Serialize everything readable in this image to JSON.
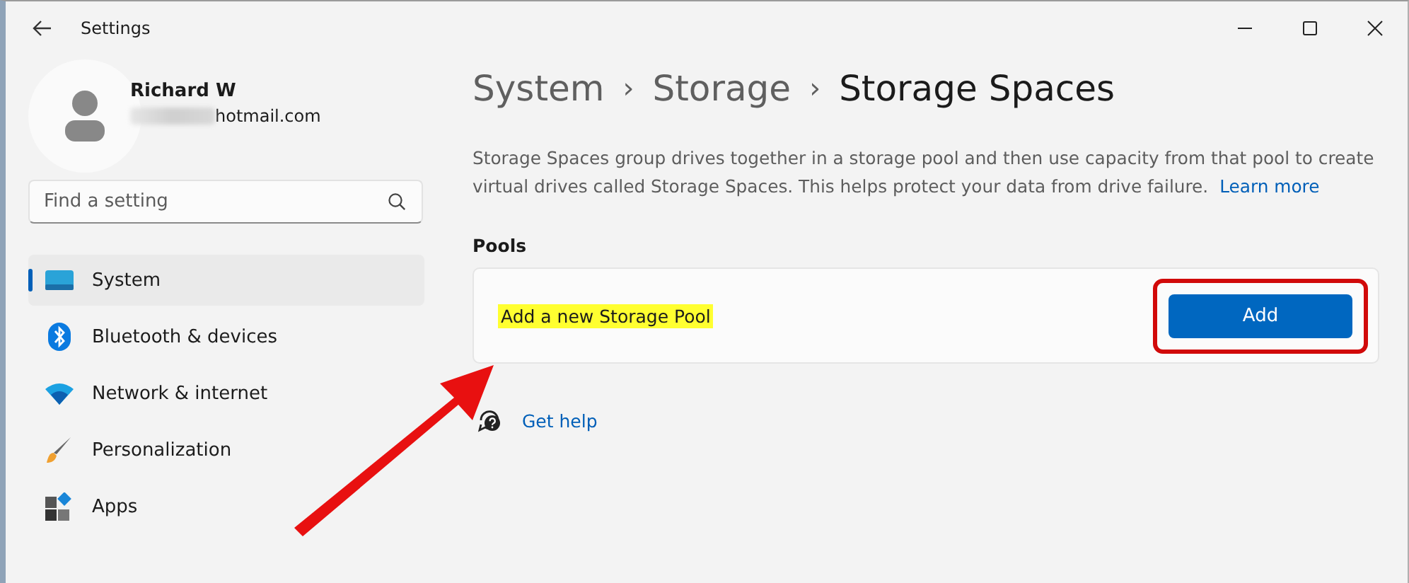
{
  "window": {
    "title": "Settings"
  },
  "account": {
    "name": "Richard W",
    "email": "hotmail.com",
    "email_blurred": true
  },
  "search": {
    "placeholder": "Find a setting"
  },
  "sidebar": {
    "items": [
      {
        "label": "System",
        "kind": "system",
        "selected": true
      },
      {
        "label": "Bluetooth & devices",
        "kind": "bluetooth",
        "selected": false
      },
      {
        "label": "Network & internet",
        "kind": "network",
        "selected": false
      },
      {
        "label": "Personalization",
        "kind": "personalization",
        "selected": false
      },
      {
        "label": "Apps",
        "kind": "apps",
        "selected": false
      }
    ]
  },
  "breadcrumb": [
    {
      "label": "System",
      "current": false
    },
    {
      "label": "Storage",
      "current": false
    },
    {
      "label": "Storage Spaces",
      "current": true
    }
  ],
  "separator": "›",
  "description": {
    "text": "Storage Spaces group drives together in a storage pool and then use capacity from that pool to create virtual drives called Storage Spaces. This helps protect your data from drive failure.",
    "link": "Learn more"
  },
  "pools": {
    "heading": "Pools",
    "label": "Add a new Storage Pool",
    "highlighted": true,
    "button": "Add",
    "button_outlined": true
  },
  "help": {
    "label": "Get help"
  },
  "annotations": [
    {
      "kind": "arrow"
    }
  ]
}
